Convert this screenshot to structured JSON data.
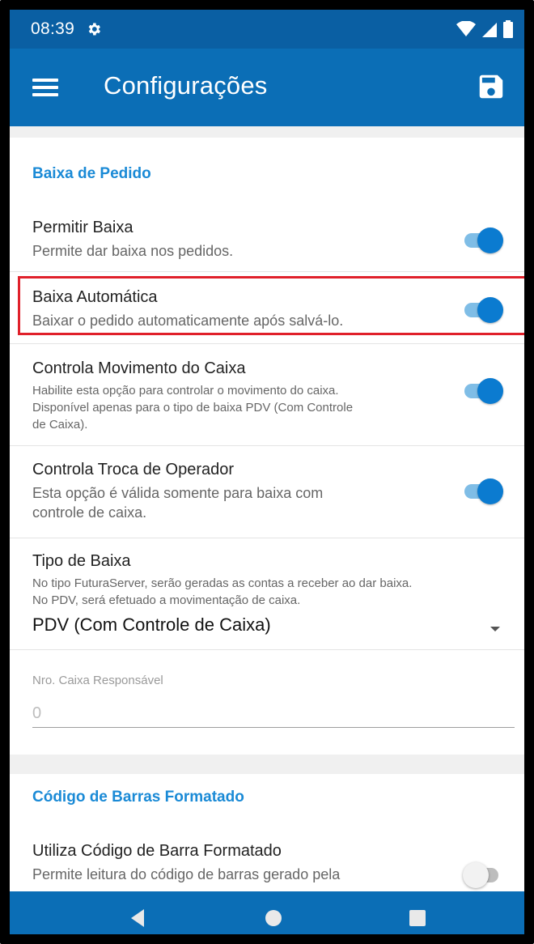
{
  "status_bar": {
    "time": "08:39",
    "icons": [
      "gear-icon",
      "wifi-icon",
      "signal-icon",
      "battery-icon"
    ]
  },
  "app_bar": {
    "title": "Configurações",
    "icons": [
      "menu-icon",
      "save-icon"
    ]
  },
  "sections": {
    "baixa": {
      "title": "Baixa de Pedido",
      "permitir_baixa": {
        "title": "Permitir Baixa",
        "subtitle": "Permite dar baixa nos pedidos.",
        "enabled": true
      },
      "baixa_automatica": {
        "title": "Baixa Automática",
        "subtitle": "Baixar o pedido automaticamente após salvá-lo.",
        "enabled": true,
        "highlighted": true
      },
      "controla_movimento": {
        "title": "Controla Movimento do Caixa",
        "subtitle_line1": "Habilite esta opção para controlar o movimento do caixa.",
        "subtitle_line2": "Disponível apenas para o tipo de baixa PDV (Com Controle",
        "subtitle_line3": "de Caixa).",
        "enabled": true
      },
      "controla_troca": {
        "title": "Controla Troca de Operador",
        "subtitle_line1": "Esta opção é válida somente para baixa com",
        "subtitle_line2": "controle de caixa.",
        "enabled": true
      },
      "tipo_baixa": {
        "title": "Tipo de Baixa",
        "subtitle_line1": "No tipo FuturaServer, serão geradas as contas a receber ao dar baixa.",
        "subtitle_line2": "No PDV, será efetuado a movimentação de caixa.",
        "selected": "PDV (Com Controle de Caixa)"
      },
      "nro_caixa": {
        "label": "Nro. Caixa Responsável",
        "value": "0"
      }
    },
    "codigo_barras": {
      "title": "Código de Barras Formatado",
      "utiliza": {
        "title": "Utiliza Código de Barra Formatado",
        "subtitle": "Permite leitura do código de barras gerado pela",
        "enabled": false
      }
    }
  },
  "nav_bar": {
    "icons": [
      "back-icon",
      "home-icon",
      "recents-icon"
    ]
  },
  "colors": {
    "status_bar": "#0a5fa3",
    "app_bar": "#0b6eb6",
    "accent": "#1a8ad6",
    "toggle_on": "#0b7bd0",
    "highlight_border": "#e0202a"
  }
}
